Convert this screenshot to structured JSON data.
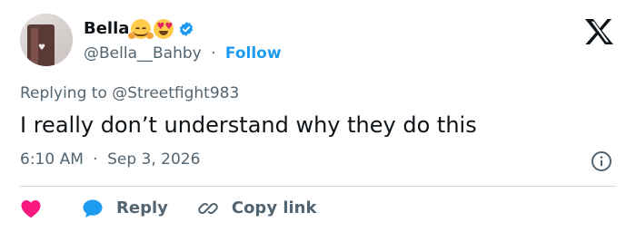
{
  "author": {
    "name": "Bella",
    "handle": "@Bella__Bahby",
    "follow_label": "Follow",
    "separator": "·",
    "name_emojis": [
      "smiling-face-with-hearts",
      "heart-eyes"
    ],
    "verified_color": "#1d9bf0"
  },
  "tweet": {
    "replying_to": "Replying to @Streetfight983",
    "text": "I really don’t understand why they do this",
    "time": "6:10 AM",
    "meta_separator": "·",
    "date": "Sep 3, 2026"
  },
  "actions": {
    "reply_label": "Reply",
    "copy_link_label": "Copy link"
  },
  "colors": {
    "accent": "#1d9bf0",
    "like": "#f91880",
    "text": "#0f1419",
    "muted": "#536471",
    "divider": "#cfd9de"
  },
  "icons": [
    "x-logo",
    "verified-badge-icon",
    "info-icon",
    "heart-icon",
    "reply-bubble-icon",
    "link-icon"
  ]
}
